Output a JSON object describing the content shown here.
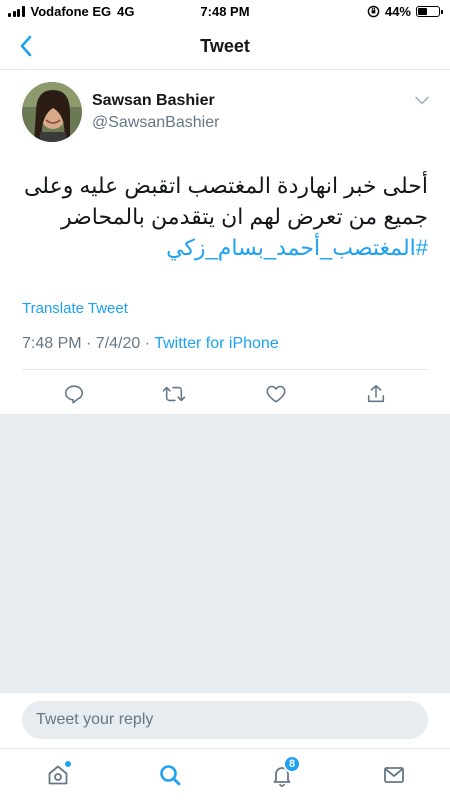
{
  "status_bar": {
    "carrier": "Vodafone EG",
    "network": "4G",
    "time": "7:48 PM",
    "battery": "44%",
    "battery_level": 0.44
  },
  "nav": {
    "title": "Tweet",
    "back_icon": "chevron-left-icon"
  },
  "tweet": {
    "author_name": "Sawsan Bashier",
    "author_handle": "@SawsanBashier",
    "text_line1": "أحلى خبر انهاردة المغتصب اتقبض عليه وعلى",
    "text_line2": "جميع من تعرض لهم ان يتقدمن بالمحاضر",
    "hashtag": "#المغتصب_أحمد_بسام_زكي",
    "translate_label": "Translate Tweet",
    "timestamp": "7:48 PM · 7/4/20 · ",
    "source": "Twitter for iPhone"
  },
  "actions": {
    "reply_icon": "reply-icon",
    "retweet_icon": "retweet-icon",
    "like_icon": "heart-icon",
    "share_icon": "share-icon"
  },
  "reply": {
    "placeholder": "Tweet your reply"
  },
  "tab_bar": {
    "notifications_badge": "8"
  },
  "colors": {
    "accent": "#1da1f2",
    "secondary_text": "#657786",
    "divider": "#e1e8ed",
    "background_gray": "#e6ecf0"
  }
}
